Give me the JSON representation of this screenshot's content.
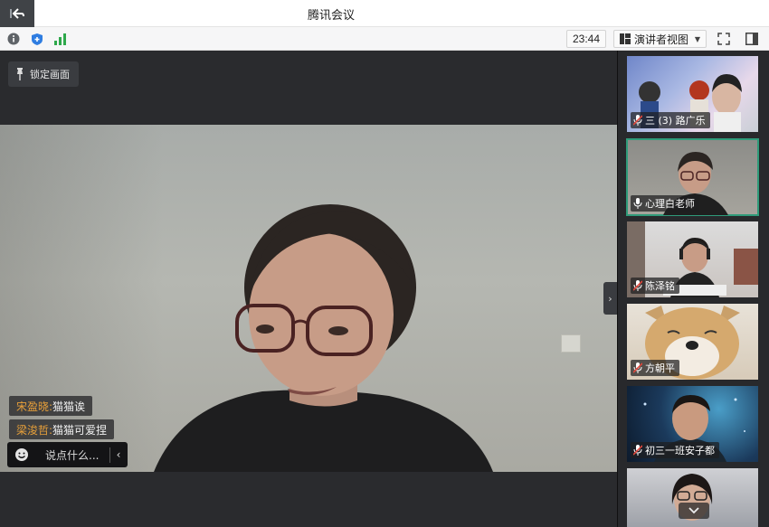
{
  "window": {
    "title": "腾讯会议"
  },
  "toolbar": {
    "time": "23:44",
    "view_label": "演讲者视图"
  },
  "stage": {
    "lock_label": "锁定画面",
    "chat_messages": [
      {
        "name": "宋盈晓:",
        "text": "猫猫诶"
      },
      {
        "name": "梁浚哲:",
        "text": "猫猫可爱捏"
      }
    ],
    "chat_placeholder": "说点什么..."
  },
  "participants": [
    {
      "name": "三 (3) 路广乐",
      "mic": "muted"
    },
    {
      "name": "心理白老师",
      "mic": "on"
    },
    {
      "name": "陈泽铭",
      "mic": "muted"
    },
    {
      "name": "方朝平",
      "mic": "muted"
    },
    {
      "name": "初三一班安子都",
      "mic": "muted"
    },
    {
      "name": "",
      "mic": ""
    }
  ],
  "colors": {
    "accent": "#2f9b7a",
    "chat_name": "#e8a03a",
    "muted": "#e0473c"
  }
}
